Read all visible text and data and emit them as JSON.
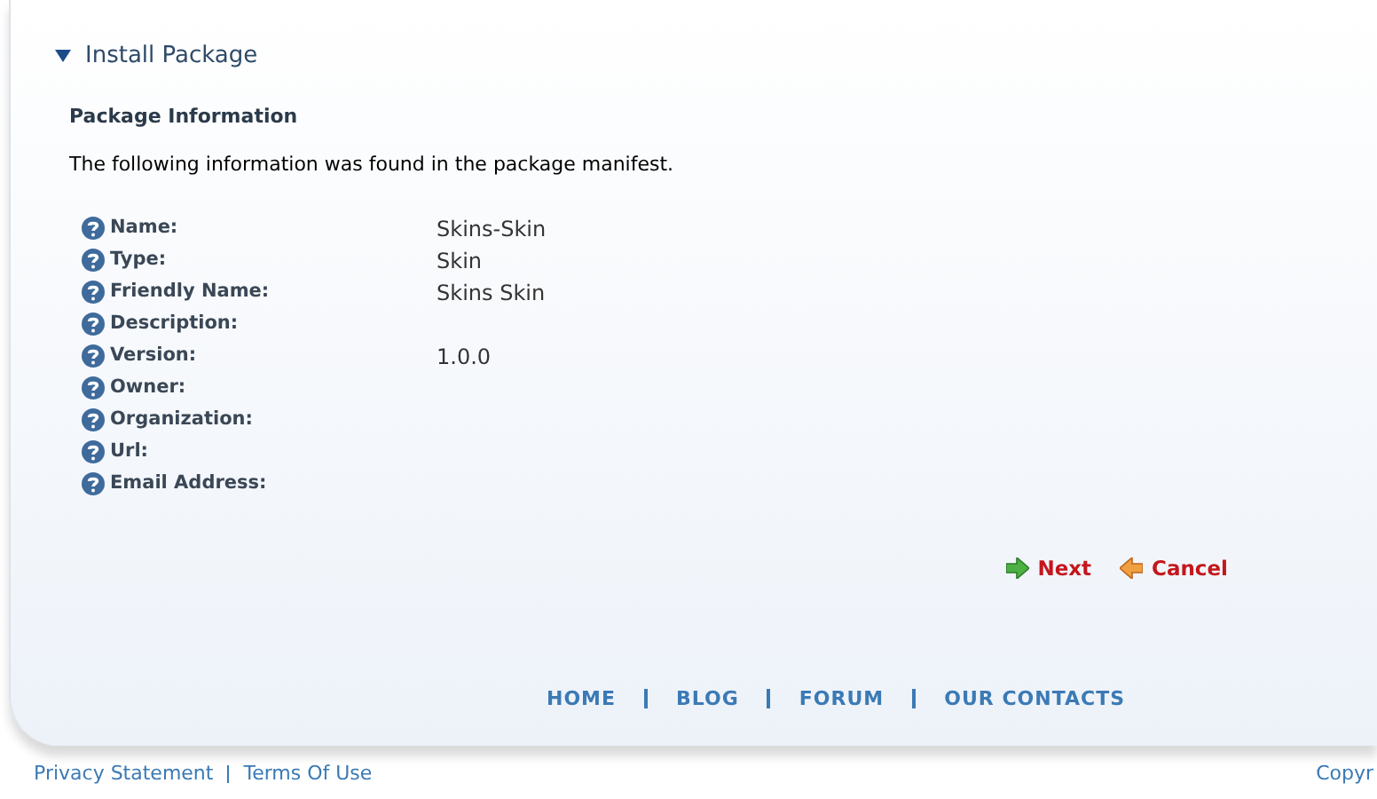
{
  "section": {
    "title": "Install Package",
    "expanded": true
  },
  "heading": "Package Information",
  "intro": "The following information was found in the package manifest.",
  "fields": [
    {
      "label": "Name:",
      "value": "Skins-Skin"
    },
    {
      "label": "Type:",
      "value": "Skin"
    },
    {
      "label": "Friendly Name:",
      "value": "Skins Skin"
    },
    {
      "label": "Description:"
    },
    {
      "label": "Version:",
      "value": "1.0.0"
    },
    {
      "label": "Owner:"
    },
    {
      "label": "Organization:"
    },
    {
      "label": "Url:"
    },
    {
      "label": "Email Address:"
    }
  ],
  "actions": [
    {
      "label": "Next",
      "kind": "next"
    },
    {
      "label": "Cancel",
      "kind": "cancel"
    }
  ],
  "nav": [
    "HOME",
    "BLOG",
    "FORUM",
    "OUR CONTACTS"
  ],
  "footer_links": [
    "Privacy Statement",
    "Terms Of Use"
  ],
  "copyright": "Copyr"
}
